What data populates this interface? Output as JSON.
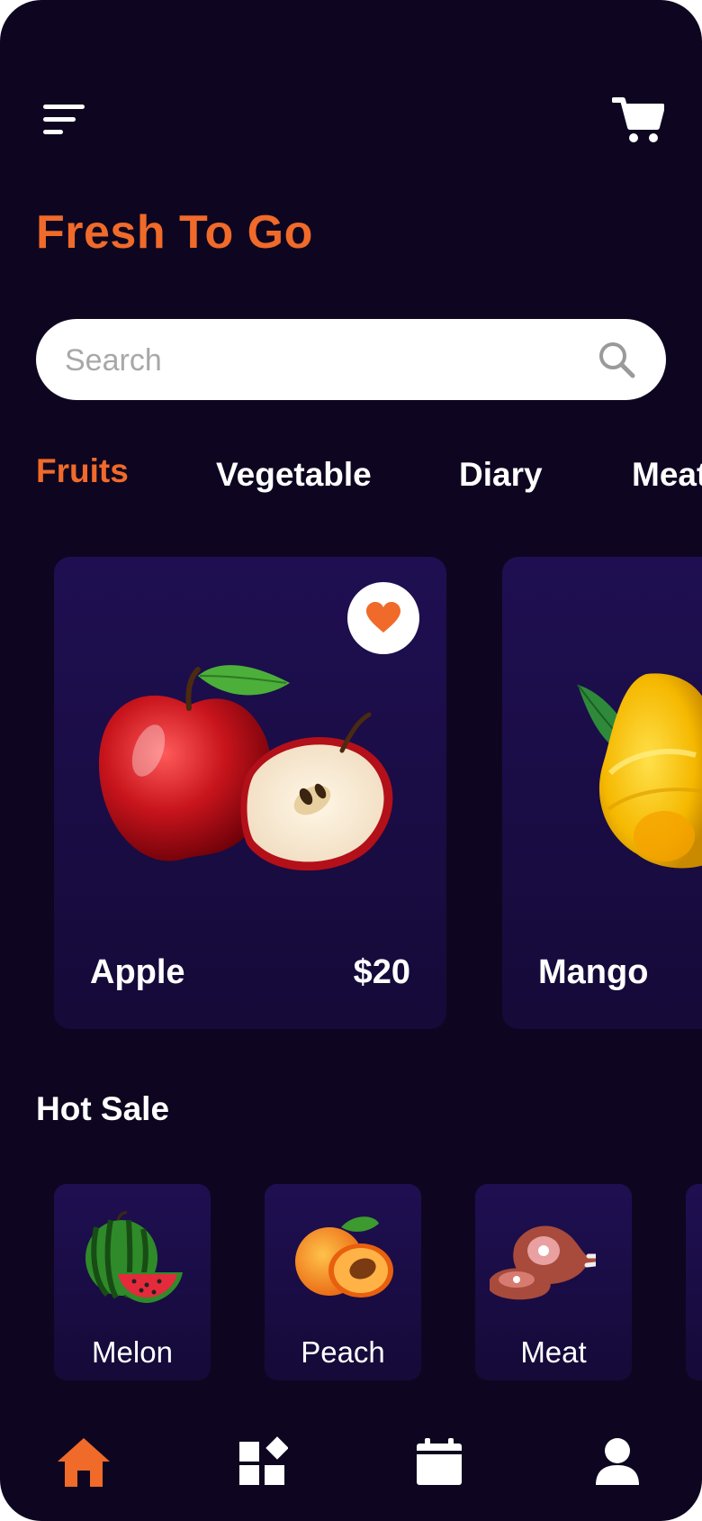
{
  "app": {
    "title": "Fresh To Go"
  },
  "header": {
    "menu_icon": "menu-icon",
    "cart_icon": "cart-icon"
  },
  "search": {
    "placeholder": "Search",
    "value": "",
    "icon": "search-icon"
  },
  "categories": [
    {
      "label": "Fruits",
      "active": true
    },
    {
      "label": "Vegetable",
      "active": false
    },
    {
      "label": "Diary",
      "active": false
    },
    {
      "label": "Meat",
      "active": false
    }
  ],
  "products": [
    {
      "name": "Apple",
      "price": "$20",
      "favorite": true
    },
    {
      "name": "Mango",
      "price": "",
      "favorite": false
    }
  ],
  "hot_sale": {
    "title": "Hot Sale",
    "items": [
      {
        "name": "Melon"
      },
      {
        "name": "Peach"
      },
      {
        "name": "Meat"
      }
    ]
  },
  "bottom_nav": [
    {
      "icon": "home-icon",
      "active": true
    },
    {
      "icon": "categories-icon",
      "active": false
    },
    {
      "icon": "calendar-icon",
      "active": false
    },
    {
      "icon": "profile-icon",
      "active": false
    }
  ],
  "colors": {
    "accent": "#f06a2a",
    "background": "#0e0620",
    "card": "#1f0f52",
    "text": "#ffffff"
  }
}
